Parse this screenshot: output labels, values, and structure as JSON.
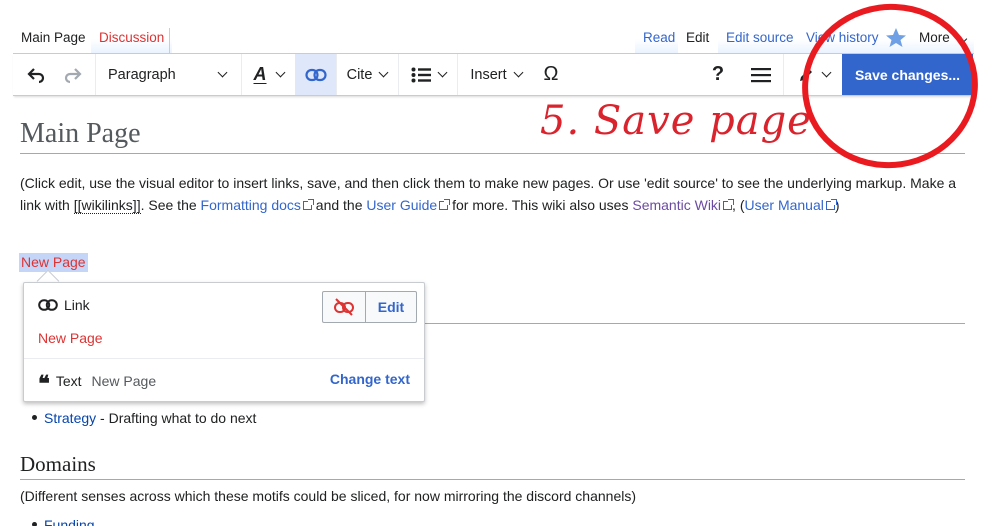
{
  "tabs": {
    "main_page": "Main Page",
    "discussion": "Discussion",
    "read": "Read",
    "edit": "Edit",
    "edit_source": "Edit source",
    "view_history": "View history",
    "more": "More"
  },
  "toolbar": {
    "paragraph": "Paragraph",
    "cite": "Cite",
    "insert": "Insert",
    "help": "?",
    "save": "Save changes..."
  },
  "content": {
    "title": "Main Page",
    "p1_a": "(Click edit, use the visual editor to insert links, save, and then click them to make new pages. Or use 'edit source' to see the underlying markup. Make a link with ",
    "p1_wikilinks": "[[wikilinks]]",
    "p1_b": ". See the ",
    "p1_formatting": "Formatting docs",
    "p1_c": " and the ",
    "p1_guide": "User Guide",
    "p1_d": " for more. This wiki also uses ",
    "p1_semantic": "Semantic Wiki",
    "p1_e": ", (",
    "p1_manual": "User Manual",
    "p1_f": ")",
    "new_page_link": "New Page",
    "bullet_strategy": "Strategy",
    "bullet_strategy_desc": " - Drafting what to do next",
    "domains_heading": "Domains",
    "domains_para": "(Different senses across which these motifs could be sliced, for now mirroring the discord channels)",
    "bullet_funding": "Funding"
  },
  "popup": {
    "link_label": "Link",
    "edit_button": "Edit",
    "target": "New Page",
    "text_label": "Text",
    "text_value": "New Page",
    "change_text": "Change text"
  },
  "annotation": {
    "note": "5. Save page"
  },
  "colors": {
    "accent": "#3366cc",
    "red_link": "#dd3333",
    "annotation": "#d9232d"
  }
}
